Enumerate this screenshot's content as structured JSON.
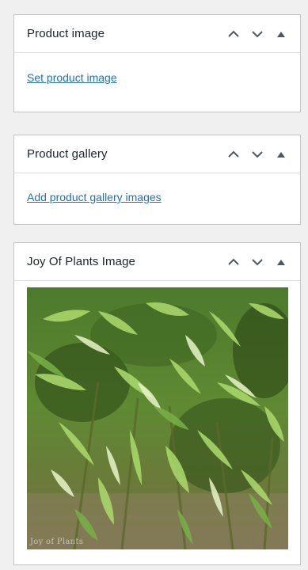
{
  "product_image": {
    "title": "Product image",
    "link": "Set product image"
  },
  "product_gallery": {
    "title": "Product gallery",
    "link": "Add product gallery images"
  },
  "joy_image": {
    "title": "Joy Of Plants Image",
    "photo_subject": "bamboo plant leaves photo",
    "watermark": "Joy of Plants"
  },
  "controls": {
    "move_up": "chevron-up-icon",
    "move_down": "chevron-down-icon",
    "toggle": "triangle-up-icon"
  },
  "colors": {
    "link": "#2271b1",
    "panel_border": "#c3c4c7",
    "background": "#f0f0f1",
    "icon": "#50575e"
  }
}
